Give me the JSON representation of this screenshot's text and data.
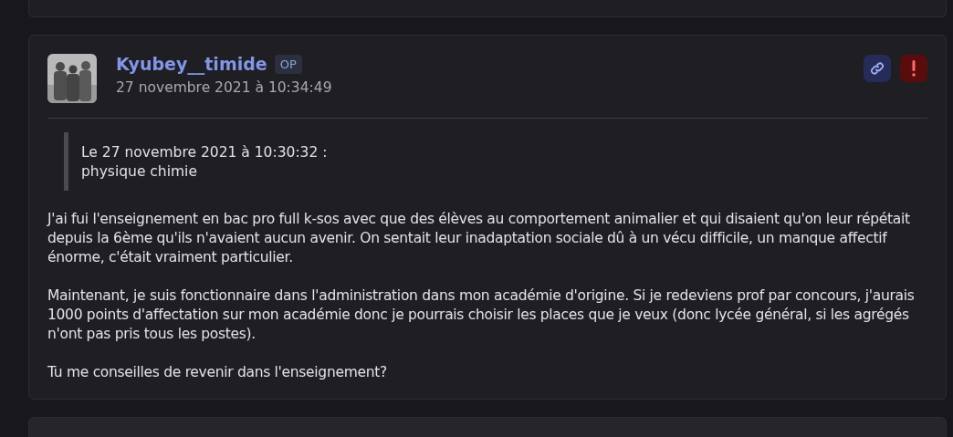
{
  "post": {
    "author": "Kyubey__timide",
    "badge": "OP",
    "date": "27 novembre 2021 à 10:34:49",
    "actions": [
      {
        "kind": "link"
      },
      {
        "kind": "report"
      }
    ],
    "quote": {
      "header": "Le 27 novembre 2021 à 10:30:32 :",
      "text": "physique chimie"
    },
    "paragraphs": [
      "J'ai fui l'enseignement en bac pro full k-sos avec que des élèves au comportement animalier et qui disaient qu'on leur répétait depuis la 6ème qu'ils n'avaient aucun avenir. On sentait leur inadaptation sociale dû à un vécu difficile, un manque affectif énorme, c'était vraiment particulier.",
      "Maintenant, je suis fonctionnaire dans l'administration dans mon académie d'origine. Si je redeviens prof par concours, j'aurais 1000 points d'affectation sur mon académie donc je pourrais choisir les places que je veux (donc lycée général, si les agrégés n'ont pas pris tous les postes).",
      "Tu me conseilles de revenir dans l'enseignement?"
    ]
  }
}
